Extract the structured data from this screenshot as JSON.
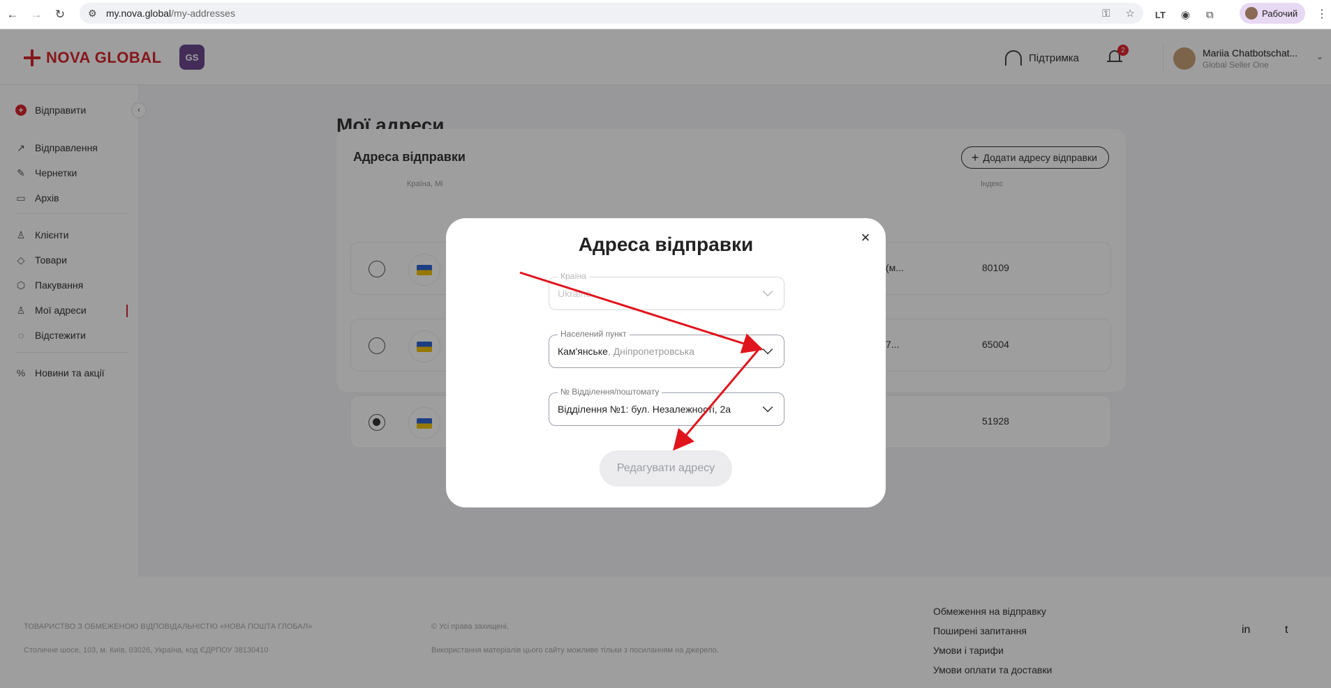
{
  "browser": {
    "url_host": "my.nova.global",
    "url_path": "/my-addresses",
    "profile_label": "Рабочий"
  },
  "header": {
    "logo_text": "NOVA GLOBAL",
    "gs_badge": "GS",
    "support_label": "Підтримка",
    "notifications_count": "2",
    "user_name": "Mariia Chatbotschat...",
    "user_company": "Global Seller One"
  },
  "sidebar": {
    "items": [
      {
        "label": "Відправити",
        "icon": "plus-circle-icon"
      },
      {
        "label": "Відправлення",
        "icon": "arrow-up-right-icon"
      },
      {
        "label": "Чернетки",
        "icon": "edit-icon"
      },
      {
        "label": "Архів",
        "icon": "archive-icon"
      },
      {
        "label": "Клієнти",
        "icon": "user-icon"
      },
      {
        "label": "Товари",
        "icon": "tag-icon"
      },
      {
        "label": "Пакування",
        "icon": "package-icon"
      },
      {
        "label": "Мої адреси",
        "icon": "location-user-icon"
      },
      {
        "label": "Відстежити",
        "icon": "track-icon"
      },
      {
        "label": "Новини та акції",
        "icon": "percent-icon"
      }
    ]
  },
  "main": {
    "page_title": "Мої адреси",
    "card_title": "Адреса відправки",
    "add_button": "Додати адресу відправки",
    "columns": [
      "Країна, Мі",
      "Індекс"
    ],
    "rows": [
      {
        "trunc": "(м...",
        "zip": "80109",
        "selected": false
      },
      {
        "trunc": "7...",
        "zip": "65004",
        "selected": false
      },
      {
        "trunc": "",
        "zip": "51928",
        "selected": true
      }
    ]
  },
  "modal": {
    "title": "Адреса відправки",
    "country_label": "Країна",
    "country_value": "Ukraine",
    "city_label": "Населений пункт",
    "city_value": "Кам'янське",
    "city_region": ", Дніпропетровська",
    "branch_label": "№ Відділення/поштомату",
    "branch_value": "Відділення №1: бул. Незалежності, 2а",
    "submit_label": "Редагувати адресу"
  },
  "footer": {
    "company": "ТОВАРИСТВО З ОБМЕЖЕНОЮ ВІДПОВІДАЛЬНІСТЮ «НОВА ПОШТА ГЛОБАЛ»",
    "address": "Столичне шосе, 103, м. Київ, 03026, Україна, код ЄДРПОУ 38130410",
    "rights": "© Усі права захищені.",
    "usage": "Використання матеріалів цього сайту можливе тільки з посиланням на джерело.",
    "links": [
      "Обмеження на відправку",
      "Поширені запитання",
      "Умови і тарифи",
      "Умови оплати та доставки"
    ],
    "social": [
      "in",
      "t"
    ]
  },
  "colors": {
    "brand_red": "#d7262e",
    "annotation_arrow": "#e0141c"
  }
}
